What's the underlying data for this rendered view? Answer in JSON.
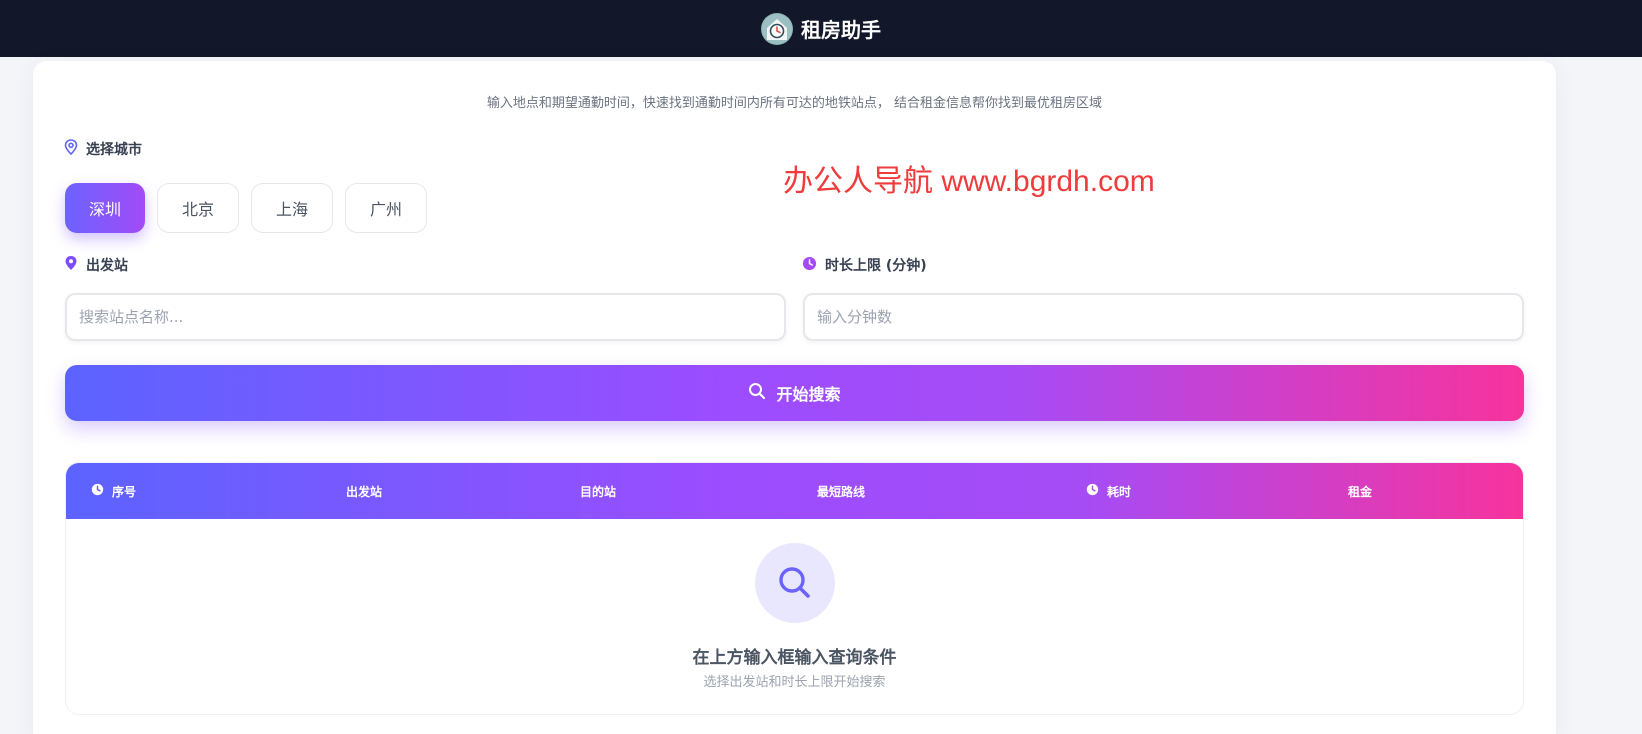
{
  "header": {
    "logo_icon": "clock-house-logo-icon",
    "title": "租房助手"
  },
  "intro": {
    "subtitle": "输入地点和期望通勤时间，快速找到通勤时间内所有可达的地铁站点， 结合租金信息帮你找到最优租房区域"
  },
  "watermark": "办公人导航  www.bgrdh.com",
  "city": {
    "label": "选择城市",
    "icon": "location-pin-outline-icon",
    "options": [
      "深圳",
      "北京",
      "上海",
      "广州"
    ],
    "selected": "深圳"
  },
  "departure": {
    "label": "出发站",
    "icon": "location-pin-icon",
    "placeholder": "搜索站点名称...",
    "value": ""
  },
  "duration": {
    "label": "时长上限 (分钟)",
    "icon": "clock-icon",
    "placeholder": "输入分钟数",
    "value": ""
  },
  "search_button": {
    "label": "开始搜索",
    "icon": "search-icon"
  },
  "table": {
    "columns": [
      "序号",
      "出发站",
      "目的站",
      "最短路线",
      "耗时",
      "租金"
    ],
    "rows": []
  },
  "empty_state": {
    "icon": "search-icon",
    "title": "在上方输入框输入查询条件",
    "subtitle": "选择出发站和时长上限开始搜索"
  },
  "colors": {
    "topbar": "#121829",
    "accent_start": "#5c63ff",
    "accent_mid": "#9b4dff",
    "accent_end": "#f7339c",
    "watermark": "#ef3b3b"
  }
}
